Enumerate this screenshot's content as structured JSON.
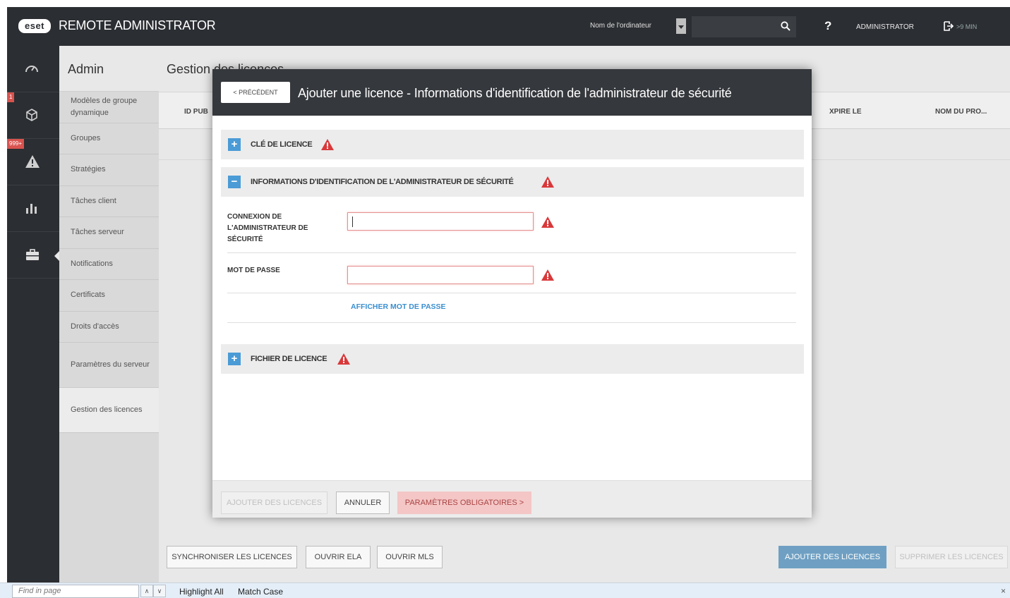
{
  "topbar": {
    "logo": "eset",
    "title": "REMOTE ADMINISTRATOR",
    "search_label": "Nom de l'ordinateur",
    "search_placeholder": "",
    "help": "?",
    "user": "ADMINISTRATOR",
    "logout_time": ">9 MIN"
  },
  "iconbar": {
    "badge_computers": "1",
    "badge_threats": "999+"
  },
  "adminnav": {
    "title": "Admin",
    "items": [
      "Modèles de groupe dynamique",
      "Groupes",
      "Stratégies",
      "Tâches client",
      "Tâches serveur",
      "Notifications",
      "Certificats",
      "Droits d'accès",
      "Paramètres du serveur",
      "Gestion des licences"
    ]
  },
  "main": {
    "title": "Gestion des licences",
    "columns": [
      "ID PUB",
      "XPIRE LE",
      "NOM DU PRO..."
    ],
    "footer_buttons": {
      "sync": "SYNCHRONISER LES LICENCES",
      "ela": "OUVRIR ELA",
      "mls": "OUVRIR MLS",
      "add": "AJOUTER DES LICENCES",
      "remove": "SUPPRIMER LES LICENCES"
    }
  },
  "modal": {
    "back": "< PRÉCÉDENT",
    "title": "Ajouter une licence - Informations d'identification de l'administrateur de sécurité",
    "sections": {
      "license_key": "CLÉ DE LICENCE",
      "credentials": "INFORMATIONS D'IDENTIFICATION DE L'ADMINISTRATEUR DE SÉCURITÉ",
      "license_file": "FICHIER DE LICENCE"
    },
    "fields": {
      "login_label": "CONNEXION DE L'ADMINISTRATEUR DE SÉCURITÉ",
      "login_value": "",
      "password_label": "MOT DE PASSE",
      "password_value": ""
    },
    "show_password": "AFFICHER MOT DE PASSE",
    "footer": {
      "add": "AJOUTER DES LICENCES",
      "cancel": "ANNULER",
      "required": "PARAMÈTRES OBLIGATOIRES >"
    }
  },
  "findbar": {
    "placeholder": "Find in page",
    "highlight_all": "Highlight All",
    "match_case": "Match Case",
    "close": "×"
  },
  "colors": {
    "topbar": "#2b2e32",
    "accent": "#4a9bd6",
    "warning": "#d9383a"
  }
}
